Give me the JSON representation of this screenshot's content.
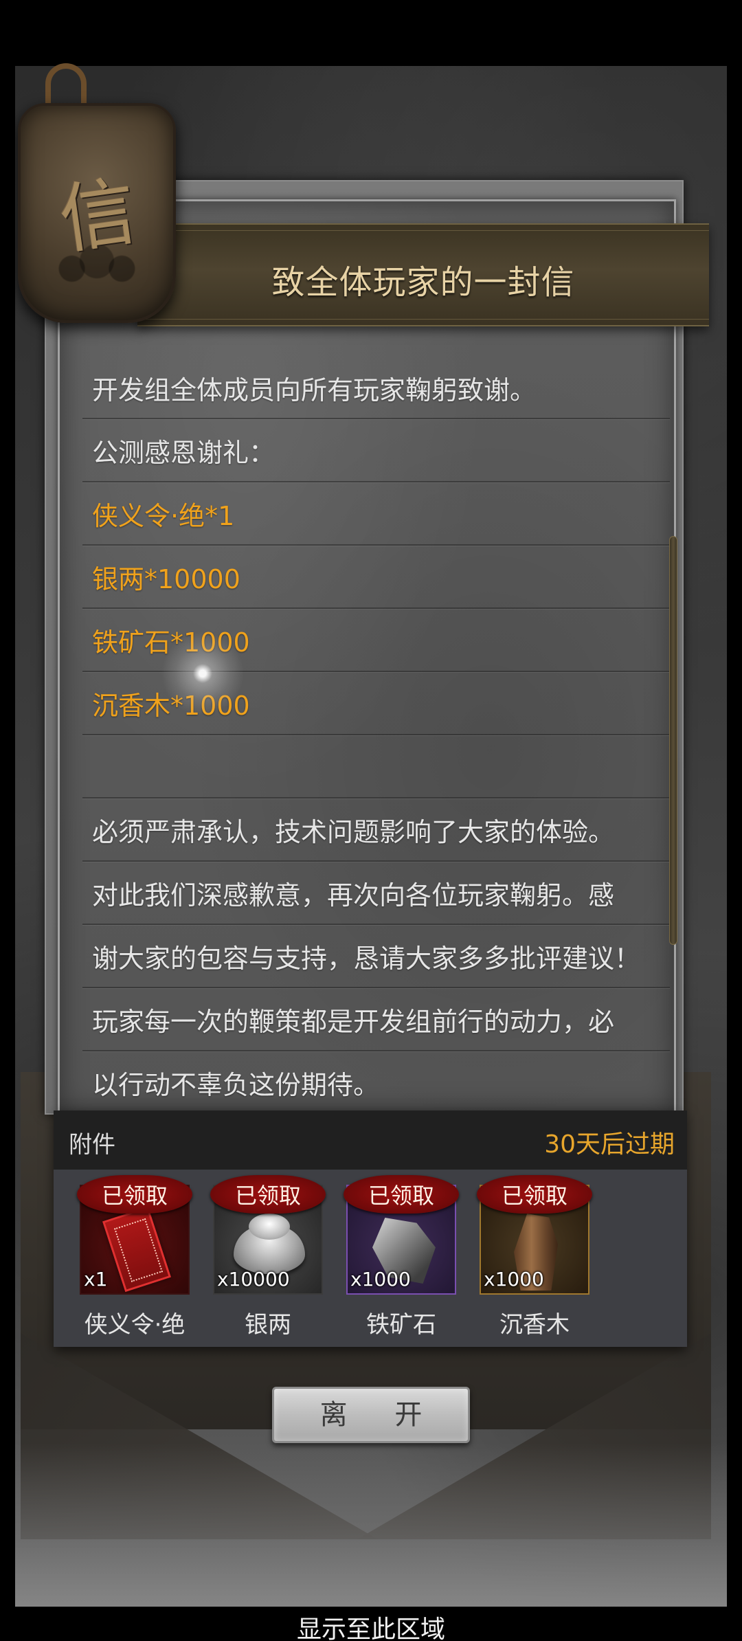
{
  "letter": {
    "title": "致全体玩家的一封信",
    "seal_char": "信",
    "lines": [
      {
        "text": "开发组全体成员向所有玩家鞠躬致谢。",
        "highlight": false
      },
      {
        "text": "公测感恩谢礼：",
        "highlight": false
      },
      {
        "text": "侠义令·绝*1",
        "highlight": true
      },
      {
        "text": "银两*10000",
        "highlight": true
      },
      {
        "text": "铁矿石*1000",
        "highlight": true
      },
      {
        "text": "沉香木*1000",
        "highlight": true
      },
      {
        "text": "",
        "highlight": false
      },
      {
        "text": "必须严肃承认，技术问题影响了大家的体验。",
        "highlight": false
      },
      {
        "text": "对此我们深感歉意，再次向各位玩家鞠躬。感",
        "highlight": false
      },
      {
        "text": "谢大家的包容与支持，恳请大家多多批评建议！",
        "highlight": false
      },
      {
        "text": "玩家每一次的鞭策都是开发组前行的动力，必",
        "highlight": false
      },
      {
        "text": "以行动不辜负这份期待。",
        "highlight": false
      }
    ]
  },
  "attachments": {
    "title": "附件",
    "expire": "30天后过期",
    "items": [
      {
        "name": "侠义令·绝",
        "qty": "x1",
        "status": "已领取",
        "icon": "xiayi-token-icon",
        "frame": "red"
      },
      {
        "name": "银两",
        "qty": "x10000",
        "status": "已领取",
        "icon": "silver-ingot-icon",
        "frame": "gray"
      },
      {
        "name": "铁矿石",
        "qty": "x1000",
        "status": "已领取",
        "icon": "iron-ore-icon",
        "frame": "purple"
      },
      {
        "name": "沉香木",
        "qty": "x1000",
        "status": "已领取",
        "icon": "agarwood-icon",
        "frame": "gold"
      }
    ]
  },
  "leave_button": {
    "label": "离 开"
  },
  "display_area_label": "显示至此区域",
  "colors": {
    "highlight_text": "#f0a21c",
    "expire_text": "#e8a62c",
    "claimed_badge": "#9e1010"
  }
}
